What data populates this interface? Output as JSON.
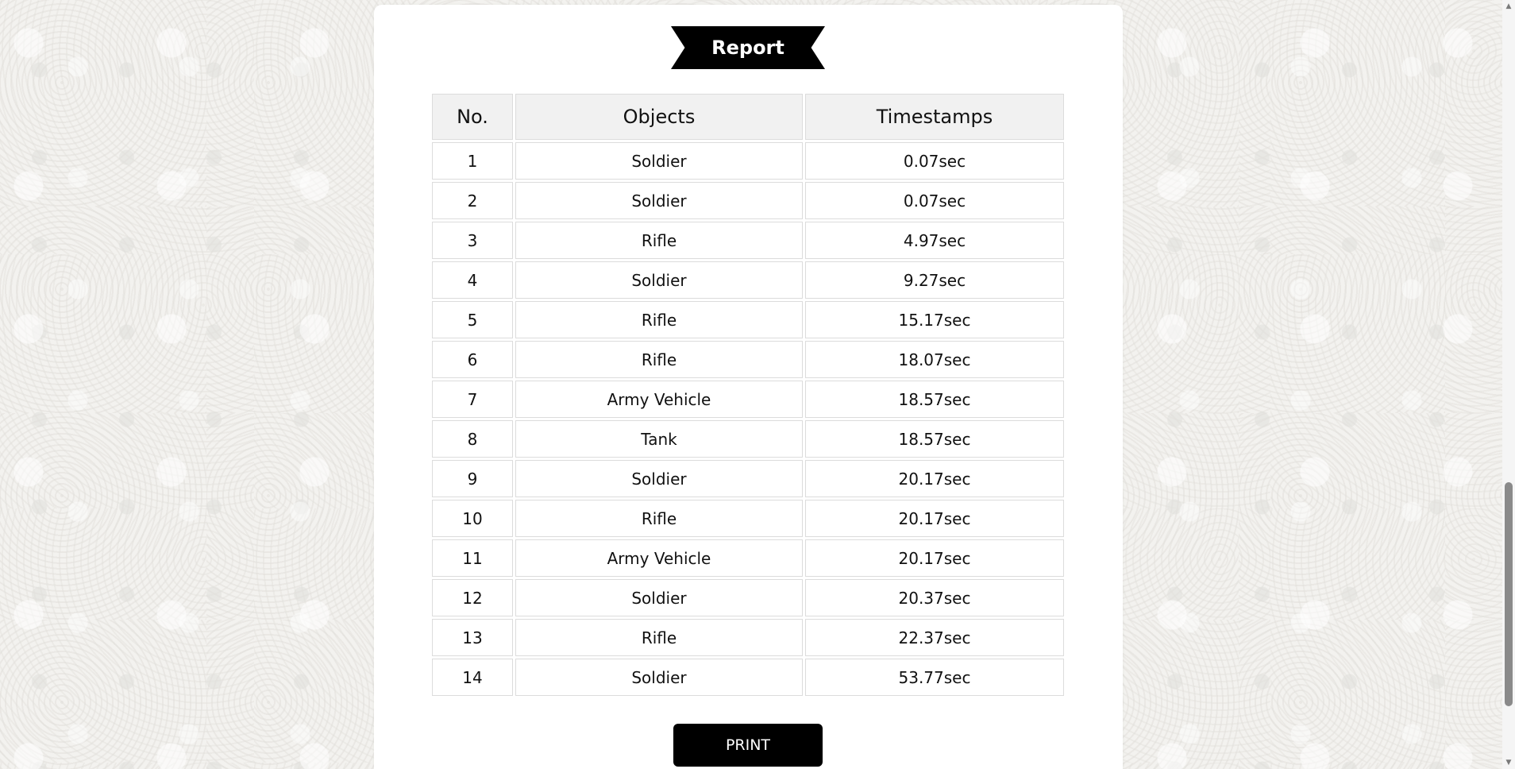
{
  "report": {
    "title": "Report",
    "columns": [
      "No.",
      "Objects",
      "Timestamps"
    ],
    "rows": [
      {
        "no": "1",
        "object": "Soldier",
        "timestamp": "0.07sec"
      },
      {
        "no": "2",
        "object": "Soldier",
        "timestamp": "0.07sec"
      },
      {
        "no": "3",
        "object": "Rifle",
        "timestamp": "4.97sec"
      },
      {
        "no": "4",
        "object": "Soldier",
        "timestamp": "9.27sec"
      },
      {
        "no": "5",
        "object": "Rifle",
        "timestamp": "15.17sec"
      },
      {
        "no": "6",
        "object": "Rifle",
        "timestamp": "18.07sec"
      },
      {
        "no": "7",
        "object": "Army Vehicle",
        "timestamp": "18.57sec"
      },
      {
        "no": "8",
        "object": "Tank",
        "timestamp": "18.57sec"
      },
      {
        "no": "9",
        "object": "Soldier",
        "timestamp": "20.17sec"
      },
      {
        "no": "10",
        "object": "Rifle",
        "timestamp": "20.17sec"
      },
      {
        "no": "11",
        "object": "Army Vehicle",
        "timestamp": "20.17sec"
      },
      {
        "no": "12",
        "object": "Soldier",
        "timestamp": "20.37sec"
      },
      {
        "no": "13",
        "object": "Rifle",
        "timestamp": "22.37sec"
      },
      {
        "no": "14",
        "object": "Soldier",
        "timestamp": "53.77sec"
      }
    ],
    "print_label": "PRINT"
  },
  "scrollbar": {
    "up_icon": "chevron-up-icon",
    "down_icon": "chevron-down-icon",
    "position": 0.9
  },
  "colors": {
    "banner": "#000000",
    "button": "#000000",
    "panel": "#ffffff",
    "header_bg": "#f1f1f1"
  }
}
